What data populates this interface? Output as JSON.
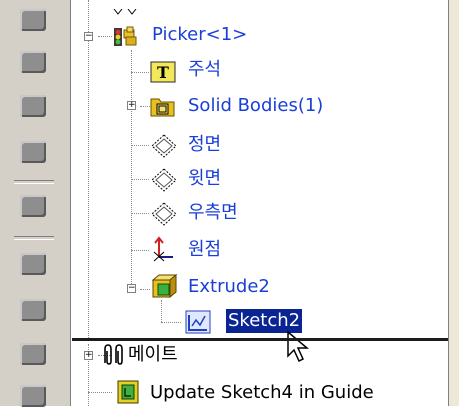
{
  "feature_tree": {
    "root_label": "Picker<1>",
    "items": [
      {
        "label": "주석",
        "icon": "annotations-icon"
      },
      {
        "label": "Solid Bodies(1)",
        "icon": "solid-bodies-folder-icon"
      },
      {
        "label": "정면",
        "icon": "front-plane-icon"
      },
      {
        "label": "윗면",
        "icon": "top-plane-icon"
      },
      {
        "label": "우측면",
        "icon": "right-plane-icon"
      },
      {
        "label": "원점",
        "icon": "origin-icon"
      },
      {
        "label": "Extrude2",
        "icon": "extrude-feature-icon"
      },
      {
        "label": "Sketch2",
        "icon": "sketch-icon"
      }
    ],
    "mates_label": "메이트",
    "last_item_label": "Update Sketch4 in Guide"
  },
  "colors": {
    "link_blue": "#1a3fd8",
    "selection_bg": "#0a2494",
    "toolbar_bg": "#d4d0c8"
  }
}
